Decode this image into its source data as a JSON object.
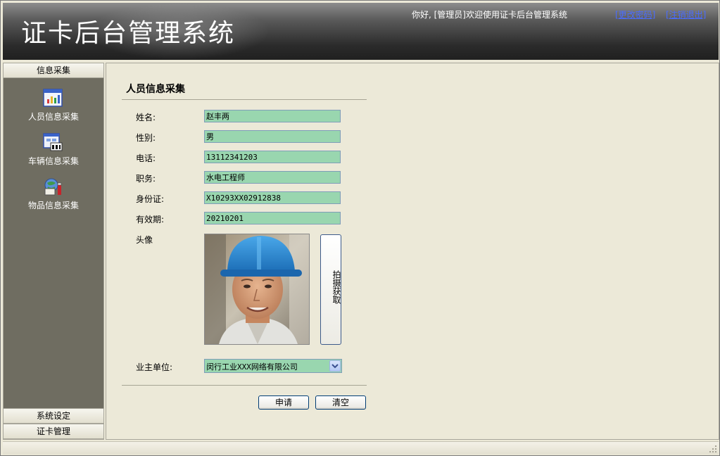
{
  "header": {
    "title": "证卡后台管理系统",
    "welcome": "你好, [管理员]欢迎使用证卡后台管理系统",
    "change_password": "[更改密码]",
    "logout": "[注销退出]"
  },
  "sidebar": {
    "section_collect": "信息采集",
    "items": [
      {
        "label": "人员信息采集",
        "icon": "person-info-icon"
      },
      {
        "label": "车辆信息采集",
        "icon": "vehicle-info-icon"
      },
      {
        "label": "物品信息采集",
        "icon": "goods-info-icon"
      }
    ],
    "section_settings": "系统设定",
    "section_card": "证卡管理"
  },
  "form": {
    "title": "人员信息采集",
    "fields": [
      {
        "label": "姓名:",
        "value": "赵丰两"
      },
      {
        "label": "性别:",
        "value": "男"
      },
      {
        "label": "电话:",
        "value": "13112341203"
      },
      {
        "label": "职务:",
        "value": "水电工程师"
      },
      {
        "label": "身份证:",
        "value": "X10293XX02912838"
      },
      {
        "label": "有效期:",
        "value": "20210201"
      }
    ],
    "photo_label": "头像",
    "capture_button": "拍摄获取",
    "owner_label": "业主单位:",
    "owner_value": "闵行工业XXX网络有限公司",
    "apply_button": "申请",
    "clear_button": "清空"
  },
  "colors": {
    "input_bg": "#99D6AF",
    "sidebar_bg": "#6F6D61",
    "header_bg": "#2b2b2b",
    "link": "#4a6cff"
  }
}
